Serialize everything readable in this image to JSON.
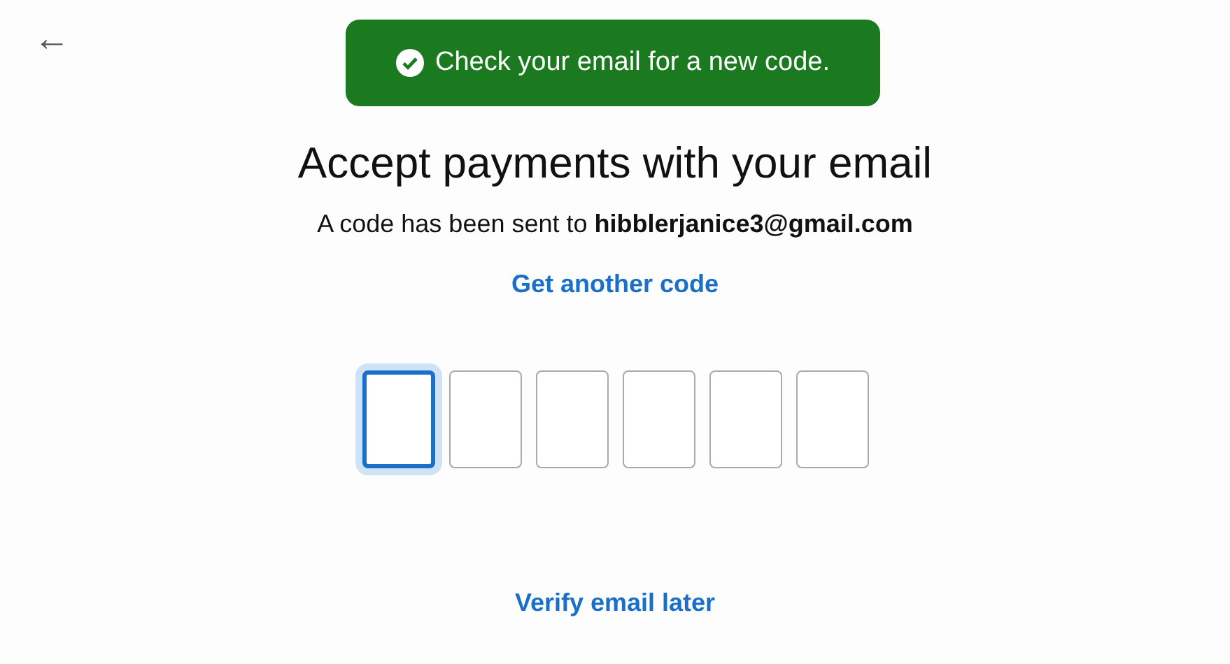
{
  "back_button": {
    "label": "←"
  },
  "toast": {
    "message": "Check your email for a new code.",
    "kind": "success"
  },
  "heading": "Accept payments with your email",
  "subtitle": "A code has been sent to **hibblerjanice3@gmail.com**",
  "resend_link": "Get another code",
  "code_boxes": [
    {
      "focused": true
    },
    {
      "focused": false
    },
    {
      "focused": false
    },
    {
      "focused": false
    },
    {
      "focused": false
    },
    {
      "focused": false
    }
  ],
  "later_link": "Verify email later"
}
